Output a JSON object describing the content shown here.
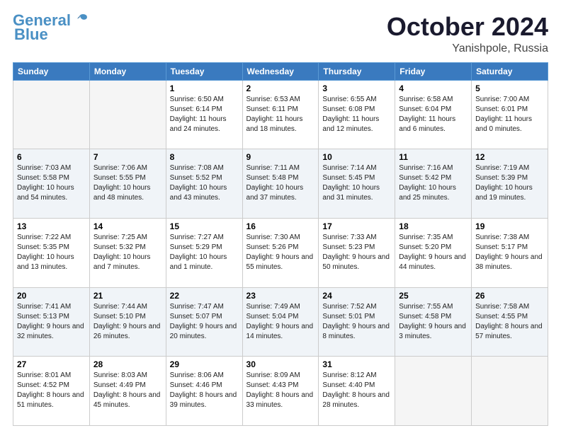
{
  "logo": {
    "line1": "General",
    "line2": "Blue"
  },
  "header": {
    "month": "October 2024",
    "location": "Yanishpole, Russia"
  },
  "weekdays": [
    "Sunday",
    "Monday",
    "Tuesday",
    "Wednesday",
    "Thursday",
    "Friday",
    "Saturday"
  ],
  "weeks": [
    [
      {
        "day": "",
        "empty": true
      },
      {
        "day": "",
        "empty": true
      },
      {
        "day": "1",
        "sunrise": "Sunrise: 6:50 AM",
        "sunset": "Sunset: 6:14 PM",
        "daylight": "Daylight: 11 hours and 24 minutes."
      },
      {
        "day": "2",
        "sunrise": "Sunrise: 6:53 AM",
        "sunset": "Sunset: 6:11 PM",
        "daylight": "Daylight: 11 hours and 18 minutes."
      },
      {
        "day": "3",
        "sunrise": "Sunrise: 6:55 AM",
        "sunset": "Sunset: 6:08 PM",
        "daylight": "Daylight: 11 hours and 12 minutes."
      },
      {
        "day": "4",
        "sunrise": "Sunrise: 6:58 AM",
        "sunset": "Sunset: 6:04 PM",
        "daylight": "Daylight: 11 hours and 6 minutes."
      },
      {
        "day": "5",
        "sunrise": "Sunrise: 7:00 AM",
        "sunset": "Sunset: 6:01 PM",
        "daylight": "Daylight: 11 hours and 0 minutes."
      }
    ],
    [
      {
        "day": "6",
        "sunrise": "Sunrise: 7:03 AM",
        "sunset": "Sunset: 5:58 PM",
        "daylight": "Daylight: 10 hours and 54 minutes."
      },
      {
        "day": "7",
        "sunrise": "Sunrise: 7:06 AM",
        "sunset": "Sunset: 5:55 PM",
        "daylight": "Daylight: 10 hours and 48 minutes."
      },
      {
        "day": "8",
        "sunrise": "Sunrise: 7:08 AM",
        "sunset": "Sunset: 5:52 PM",
        "daylight": "Daylight: 10 hours and 43 minutes."
      },
      {
        "day": "9",
        "sunrise": "Sunrise: 7:11 AM",
        "sunset": "Sunset: 5:48 PM",
        "daylight": "Daylight: 10 hours and 37 minutes."
      },
      {
        "day": "10",
        "sunrise": "Sunrise: 7:14 AM",
        "sunset": "Sunset: 5:45 PM",
        "daylight": "Daylight: 10 hours and 31 minutes."
      },
      {
        "day": "11",
        "sunrise": "Sunrise: 7:16 AM",
        "sunset": "Sunset: 5:42 PM",
        "daylight": "Daylight: 10 hours and 25 minutes."
      },
      {
        "day": "12",
        "sunrise": "Sunrise: 7:19 AM",
        "sunset": "Sunset: 5:39 PM",
        "daylight": "Daylight: 10 hours and 19 minutes."
      }
    ],
    [
      {
        "day": "13",
        "sunrise": "Sunrise: 7:22 AM",
        "sunset": "Sunset: 5:35 PM",
        "daylight": "Daylight: 10 hours and 13 minutes."
      },
      {
        "day": "14",
        "sunrise": "Sunrise: 7:25 AM",
        "sunset": "Sunset: 5:32 PM",
        "daylight": "Daylight: 10 hours and 7 minutes."
      },
      {
        "day": "15",
        "sunrise": "Sunrise: 7:27 AM",
        "sunset": "Sunset: 5:29 PM",
        "daylight": "Daylight: 10 hours and 1 minute."
      },
      {
        "day": "16",
        "sunrise": "Sunrise: 7:30 AM",
        "sunset": "Sunset: 5:26 PM",
        "daylight": "Daylight: 9 hours and 55 minutes."
      },
      {
        "day": "17",
        "sunrise": "Sunrise: 7:33 AM",
        "sunset": "Sunset: 5:23 PM",
        "daylight": "Daylight: 9 hours and 50 minutes."
      },
      {
        "day": "18",
        "sunrise": "Sunrise: 7:35 AM",
        "sunset": "Sunset: 5:20 PM",
        "daylight": "Daylight: 9 hours and 44 minutes."
      },
      {
        "day": "19",
        "sunrise": "Sunrise: 7:38 AM",
        "sunset": "Sunset: 5:17 PM",
        "daylight": "Daylight: 9 hours and 38 minutes."
      }
    ],
    [
      {
        "day": "20",
        "sunrise": "Sunrise: 7:41 AM",
        "sunset": "Sunset: 5:13 PM",
        "daylight": "Daylight: 9 hours and 32 minutes."
      },
      {
        "day": "21",
        "sunrise": "Sunrise: 7:44 AM",
        "sunset": "Sunset: 5:10 PM",
        "daylight": "Daylight: 9 hours and 26 minutes."
      },
      {
        "day": "22",
        "sunrise": "Sunrise: 7:47 AM",
        "sunset": "Sunset: 5:07 PM",
        "daylight": "Daylight: 9 hours and 20 minutes."
      },
      {
        "day": "23",
        "sunrise": "Sunrise: 7:49 AM",
        "sunset": "Sunset: 5:04 PM",
        "daylight": "Daylight: 9 hours and 14 minutes."
      },
      {
        "day": "24",
        "sunrise": "Sunrise: 7:52 AM",
        "sunset": "Sunset: 5:01 PM",
        "daylight": "Daylight: 9 hours and 8 minutes."
      },
      {
        "day": "25",
        "sunrise": "Sunrise: 7:55 AM",
        "sunset": "Sunset: 4:58 PM",
        "daylight": "Daylight: 9 hours and 3 minutes."
      },
      {
        "day": "26",
        "sunrise": "Sunrise: 7:58 AM",
        "sunset": "Sunset: 4:55 PM",
        "daylight": "Daylight: 8 hours and 57 minutes."
      }
    ],
    [
      {
        "day": "27",
        "sunrise": "Sunrise: 8:01 AM",
        "sunset": "Sunset: 4:52 PM",
        "daylight": "Daylight: 8 hours and 51 minutes."
      },
      {
        "day": "28",
        "sunrise": "Sunrise: 8:03 AM",
        "sunset": "Sunset: 4:49 PM",
        "daylight": "Daylight: 8 hours and 45 minutes."
      },
      {
        "day": "29",
        "sunrise": "Sunrise: 8:06 AM",
        "sunset": "Sunset: 4:46 PM",
        "daylight": "Daylight: 8 hours and 39 minutes."
      },
      {
        "day": "30",
        "sunrise": "Sunrise: 8:09 AM",
        "sunset": "Sunset: 4:43 PM",
        "daylight": "Daylight: 8 hours and 33 minutes."
      },
      {
        "day": "31",
        "sunrise": "Sunrise: 8:12 AM",
        "sunset": "Sunset: 4:40 PM",
        "daylight": "Daylight: 8 hours and 28 minutes."
      },
      {
        "day": "",
        "empty": true
      },
      {
        "day": "",
        "empty": true
      }
    ]
  ]
}
